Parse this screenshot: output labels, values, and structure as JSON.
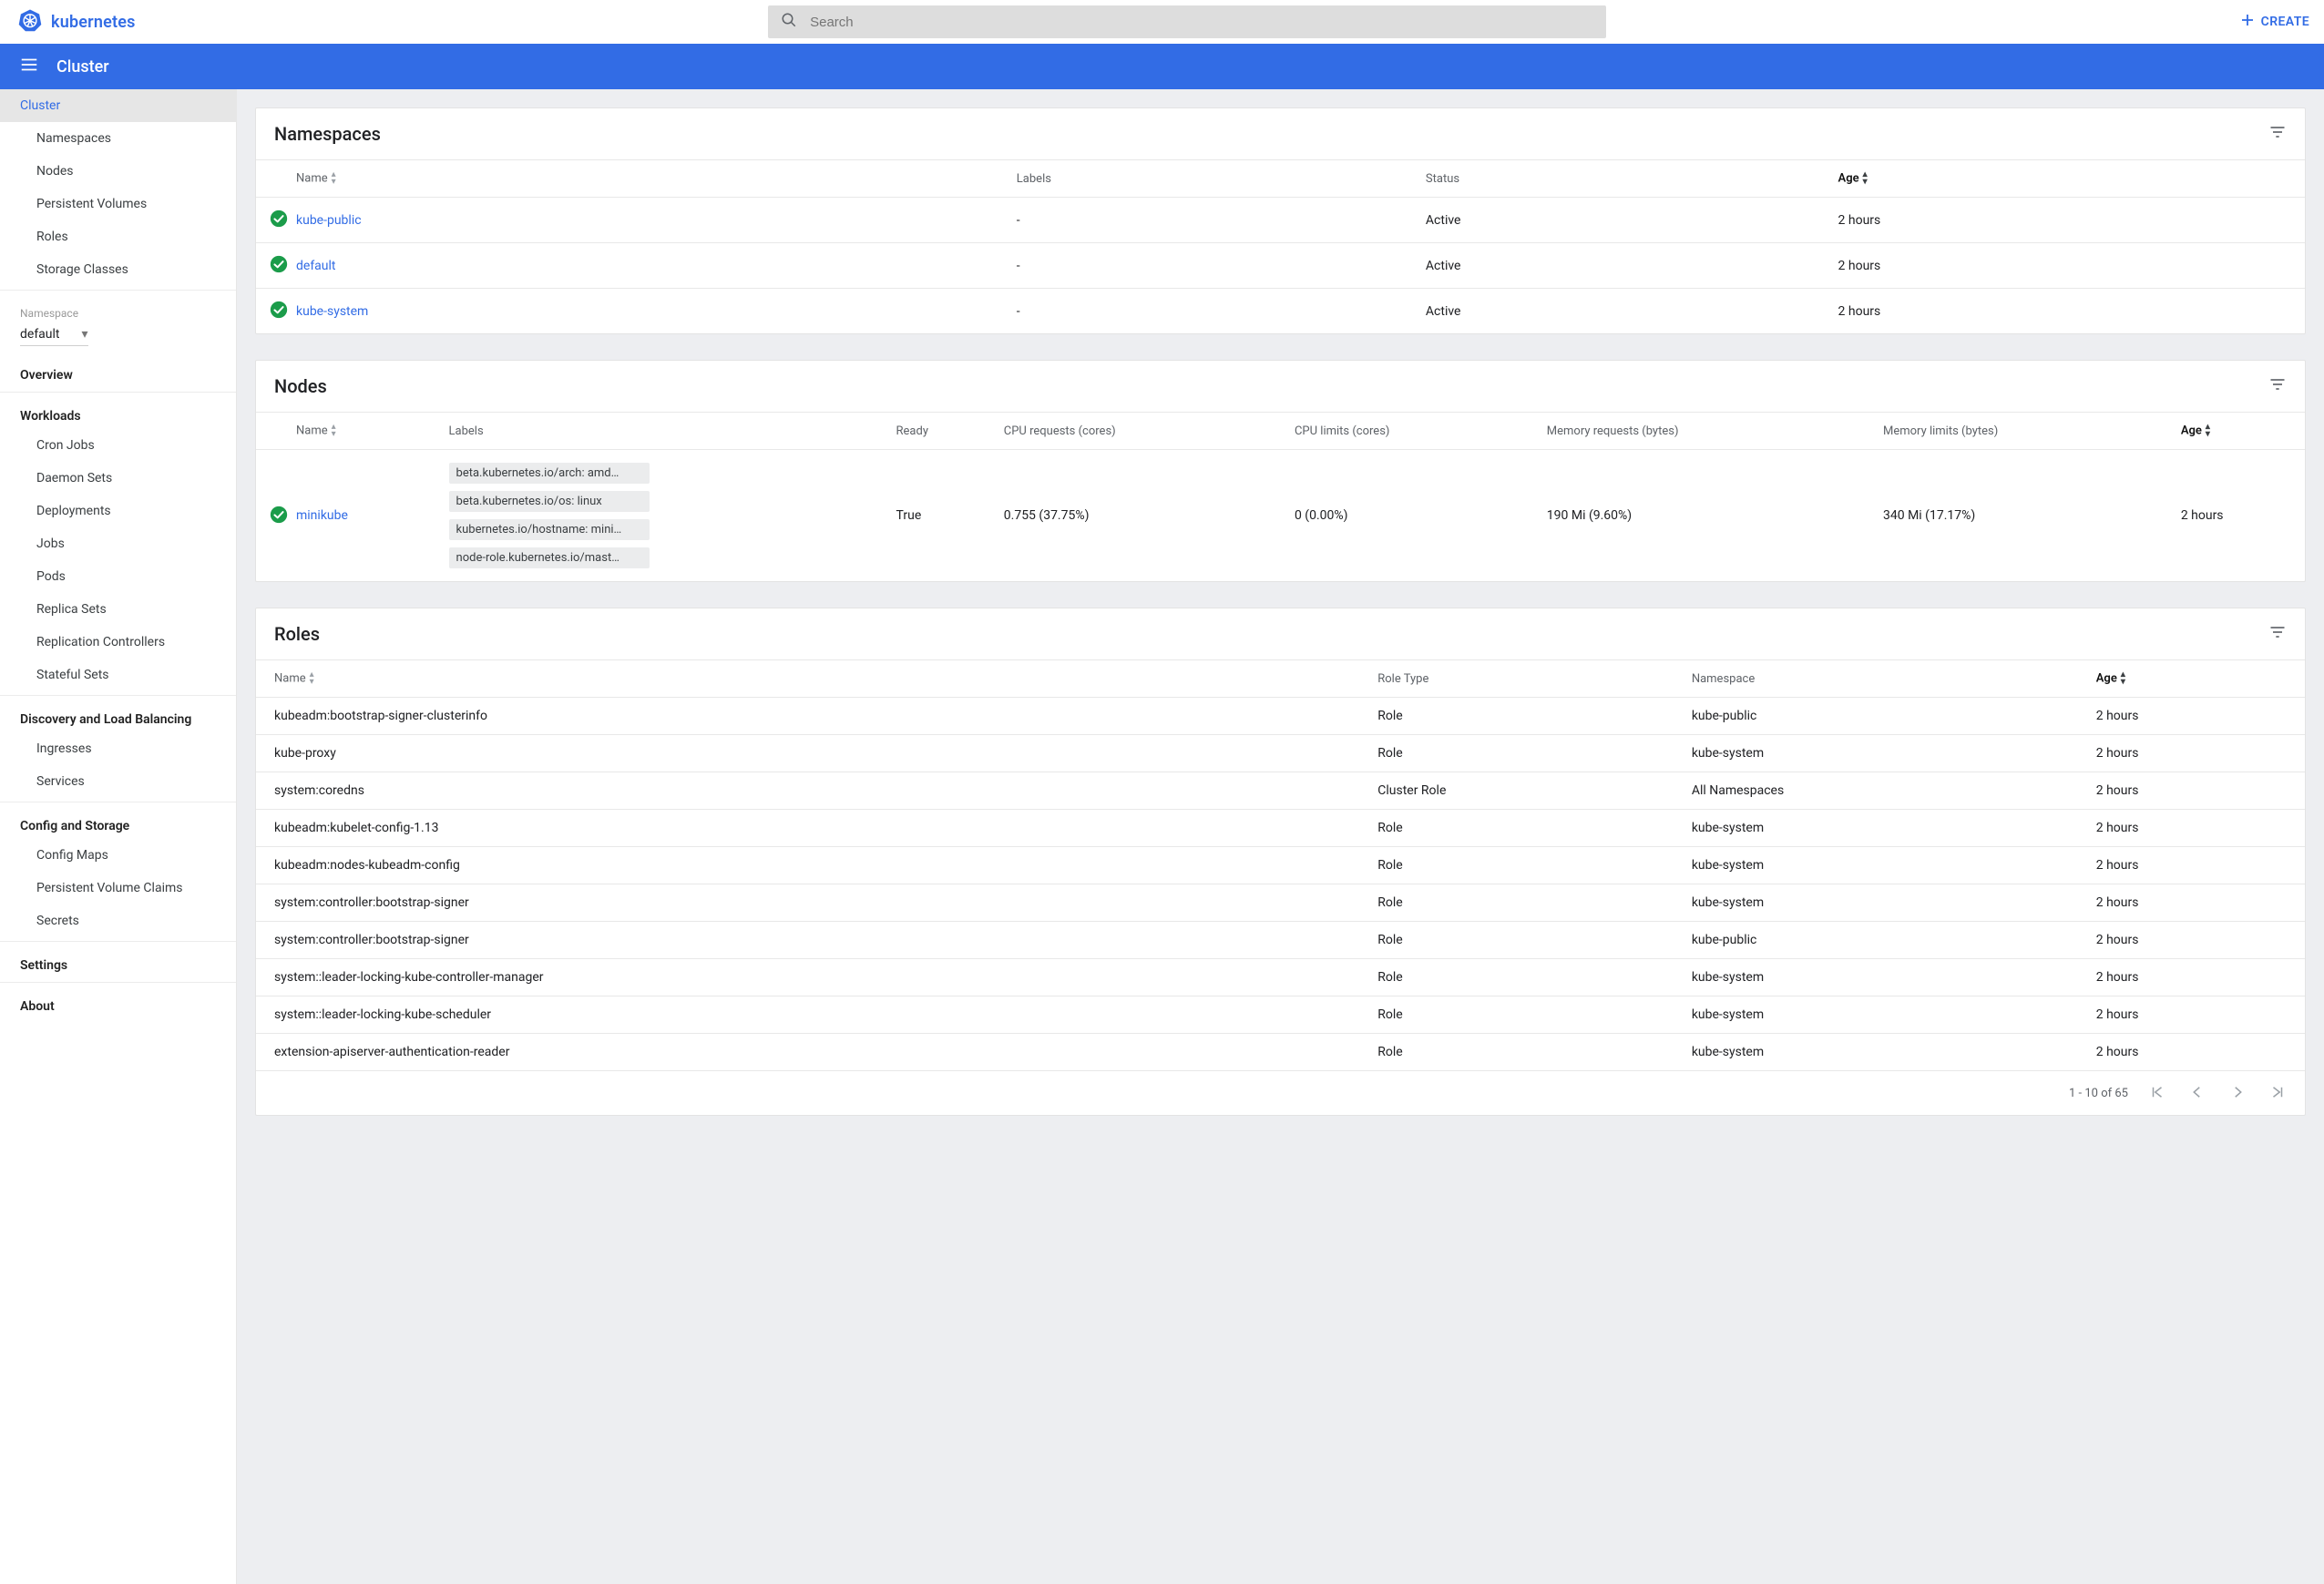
{
  "topbar": {
    "brand": "kubernetes",
    "search_placeholder": "Search",
    "create_label": "CREATE"
  },
  "bluebar": {
    "title": "Cluster"
  },
  "sidebar": {
    "cluster_group": {
      "title": "Cluster",
      "items": [
        "Namespaces",
        "Nodes",
        "Persistent Volumes",
        "Roles",
        "Storage Classes"
      ]
    },
    "namespace_label": "Namespace",
    "namespace_value": "default",
    "overview": "Overview",
    "workloads": {
      "title": "Workloads",
      "items": [
        "Cron Jobs",
        "Daemon Sets",
        "Deployments",
        "Jobs",
        "Pods",
        "Replica Sets",
        "Replication Controllers",
        "Stateful Sets"
      ]
    },
    "dlb": {
      "title": "Discovery and Load Balancing",
      "items": [
        "Ingresses",
        "Services"
      ]
    },
    "config": {
      "title": "Config and Storage",
      "items": [
        "Config Maps",
        "Persistent Volume Claims",
        "Secrets"
      ]
    },
    "settings": "Settings",
    "about": "About"
  },
  "namespaces_card": {
    "title": "Namespaces",
    "cols": {
      "name": "Name",
      "labels": "Labels",
      "status": "Status",
      "age": "Age"
    },
    "rows": [
      {
        "name": "kube-public",
        "labels": "-",
        "status": "Active",
        "age": "2 hours"
      },
      {
        "name": "default",
        "labels": "-",
        "status": "Active",
        "age": "2 hours"
      },
      {
        "name": "kube-system",
        "labels": "-",
        "status": "Active",
        "age": "2 hours"
      }
    ]
  },
  "nodes_card": {
    "title": "Nodes",
    "cols": {
      "name": "Name",
      "labels": "Labels",
      "ready": "Ready",
      "cpu_req": "CPU requests (cores)",
      "cpu_lim": "CPU limits (cores)",
      "mem_req": "Memory requests (bytes)",
      "mem_lim": "Memory limits (bytes)",
      "age": "Age"
    },
    "rows": [
      {
        "name": "minikube",
        "labels": [
          "beta.kubernetes.io/arch: amd…",
          "beta.kubernetes.io/os: linux",
          "kubernetes.io/hostname: mini…",
          "node-role.kubernetes.io/mast…"
        ],
        "ready": "True",
        "cpu_req": "0.755 (37.75%)",
        "cpu_lim": "0 (0.00%)",
        "mem_req": "190 Mi (9.60%)",
        "mem_lim": "340 Mi (17.17%)",
        "age": "2 hours"
      }
    ]
  },
  "roles_card": {
    "title": "Roles",
    "cols": {
      "name": "Name",
      "type": "Role Type",
      "ns": "Namespace",
      "age": "Age"
    },
    "rows": [
      {
        "name": "kubeadm:bootstrap-signer-clusterinfo",
        "type": "Role",
        "ns": "kube-public",
        "age": "2 hours"
      },
      {
        "name": "kube-proxy",
        "type": "Role",
        "ns": "kube-system",
        "age": "2 hours"
      },
      {
        "name": "system:coredns",
        "type": "Cluster Role",
        "ns": "All Namespaces",
        "age": "2 hours"
      },
      {
        "name": "kubeadm:kubelet-config-1.13",
        "type": "Role",
        "ns": "kube-system",
        "age": "2 hours"
      },
      {
        "name": "kubeadm:nodes-kubeadm-config",
        "type": "Role",
        "ns": "kube-system",
        "age": "2 hours"
      },
      {
        "name": "system:controller:bootstrap-signer",
        "type": "Role",
        "ns": "kube-system",
        "age": "2 hours"
      },
      {
        "name": "system:controller:bootstrap-signer",
        "type": "Role",
        "ns": "kube-public",
        "age": "2 hours"
      },
      {
        "name": "system::leader-locking-kube-controller-manager",
        "type": "Role",
        "ns": "kube-system",
        "age": "2 hours"
      },
      {
        "name": "system::leader-locking-kube-scheduler",
        "type": "Role",
        "ns": "kube-system",
        "age": "2 hours"
      },
      {
        "name": "extension-apiserver-authentication-reader",
        "type": "Role",
        "ns": "kube-system",
        "age": "2 hours"
      }
    ],
    "pager": {
      "range": "1 - 10 of 65"
    }
  }
}
